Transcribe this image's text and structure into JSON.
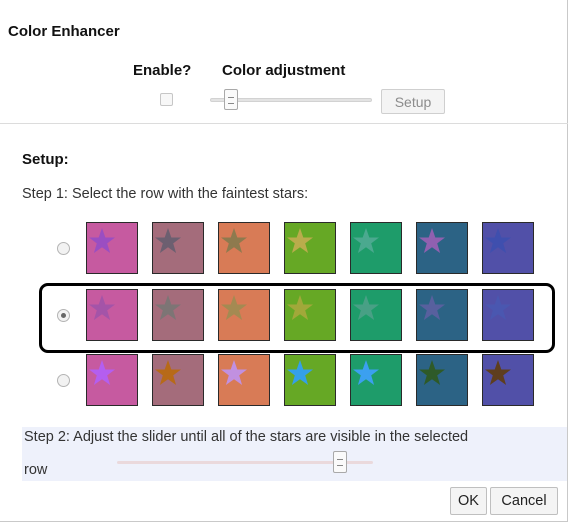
{
  "dialog": {
    "title": "Color Enhancer",
    "enable_label": "Enable?",
    "color_adjustment_label": "Color adjustment",
    "enable_checked": false,
    "color_adjustment_level": 0.1,
    "setup_button": "Setup"
  },
  "setup": {
    "heading": "Setup:",
    "step1": "Step 1: Select the row with the faintest stars:",
    "selected_row": 1,
    "rows": [
      {
        "swatches": [
          {
            "bg": "#c65aa0",
            "star": "#9a4ec2"
          },
          {
            "bg": "#a46c7b",
            "star": "#6c5f70"
          },
          {
            "bg": "#d87b56",
            "star": "#8e7a4e"
          },
          {
            "bg": "#66a825",
            "star": "#b9ac4c"
          },
          {
            "bg": "#1e9c6a",
            "star": "#4ba98f"
          },
          {
            "bg": "#2c6385",
            "star": "#9060b0"
          },
          {
            "bg": "#5150a8",
            "star": "#3f4fae"
          }
        ]
      },
      {
        "swatches": [
          {
            "bg": "#c65aa0",
            "star": "#a454a8"
          },
          {
            "bg": "#a46c7b",
            "star": "#7d7575"
          },
          {
            "bg": "#d87b56",
            "star": "#a48a52"
          },
          {
            "bg": "#66a825",
            "star": "#a1a83a"
          },
          {
            "bg": "#1e9c6a",
            "star": "#48a085"
          },
          {
            "bg": "#2c6385",
            "star": "#58609e"
          },
          {
            "bg": "#5150a8",
            "star": "#4a57b0"
          }
        ]
      },
      {
        "swatches": [
          {
            "bg": "#c65aa0",
            "star": "#b45ef0"
          },
          {
            "bg": "#a46c7b",
            "star": "#b76a18"
          },
          {
            "bg": "#d87b56",
            "star": "#c190e0"
          },
          {
            "bg": "#66a825",
            "star": "#34a0e8"
          },
          {
            "bg": "#1e9c6a",
            "star": "#3ba0f0"
          },
          {
            "bg": "#2c6385",
            "star": "#2e5a28"
          },
          {
            "bg": "#5150a8",
            "star": "#5e3e1e"
          }
        ]
      }
    ],
    "step2_line1": "Step 2: Adjust the slider until all of the stars are visible in the selected",
    "step2_line2": "row",
    "adjust_level": 0.86
  },
  "buttons": {
    "ok": "OK",
    "cancel": "Cancel"
  }
}
